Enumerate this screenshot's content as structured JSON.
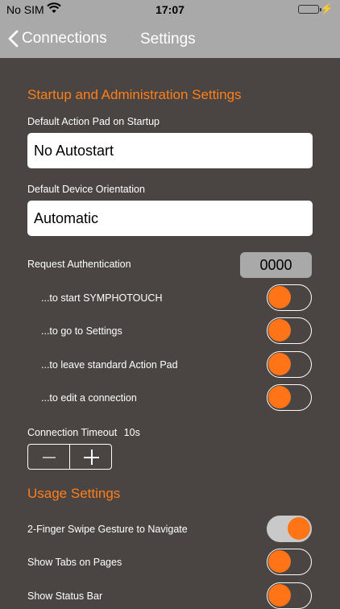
{
  "status_bar": {
    "carrier": "No SIM",
    "time": "17:07",
    "wifi_icon": "wifi-icon",
    "battery_icon": "battery-icon",
    "charging_icon": "bolt-icon"
  },
  "nav": {
    "back_label": "Connections",
    "title": "Settings"
  },
  "colors": {
    "accent": "#ff7416",
    "background": "#4a4543",
    "bar": "#a9a9a9"
  },
  "startup": {
    "title": "Startup and Administration Settings",
    "default_action_pad_label": "Default Action Pad on Startup",
    "default_action_pad_value": "No Autostart",
    "default_orientation_label": "Default Device Orientation",
    "default_orientation_value": "Automatic",
    "request_auth_label": "Request Authentication",
    "pin_value": "0000",
    "auth_options": [
      {
        "label": "...to start SYMPHOTOUCH",
        "on": false
      },
      {
        "label": "...to go to Settings",
        "on": false
      },
      {
        "label": "...to leave standard Action Pad",
        "on": false
      },
      {
        "label": "...to edit a connection",
        "on": false
      }
    ],
    "timeout_label": "Connection Timeout",
    "timeout_value": "10s"
  },
  "usage": {
    "title": "Usage Settings",
    "options": [
      {
        "label": "2-Finger Swipe Gesture to Navigate",
        "on": true
      },
      {
        "label": "Show Tabs on Pages",
        "on": false
      },
      {
        "label": "Show Status Bar",
        "on": false
      }
    ]
  }
}
